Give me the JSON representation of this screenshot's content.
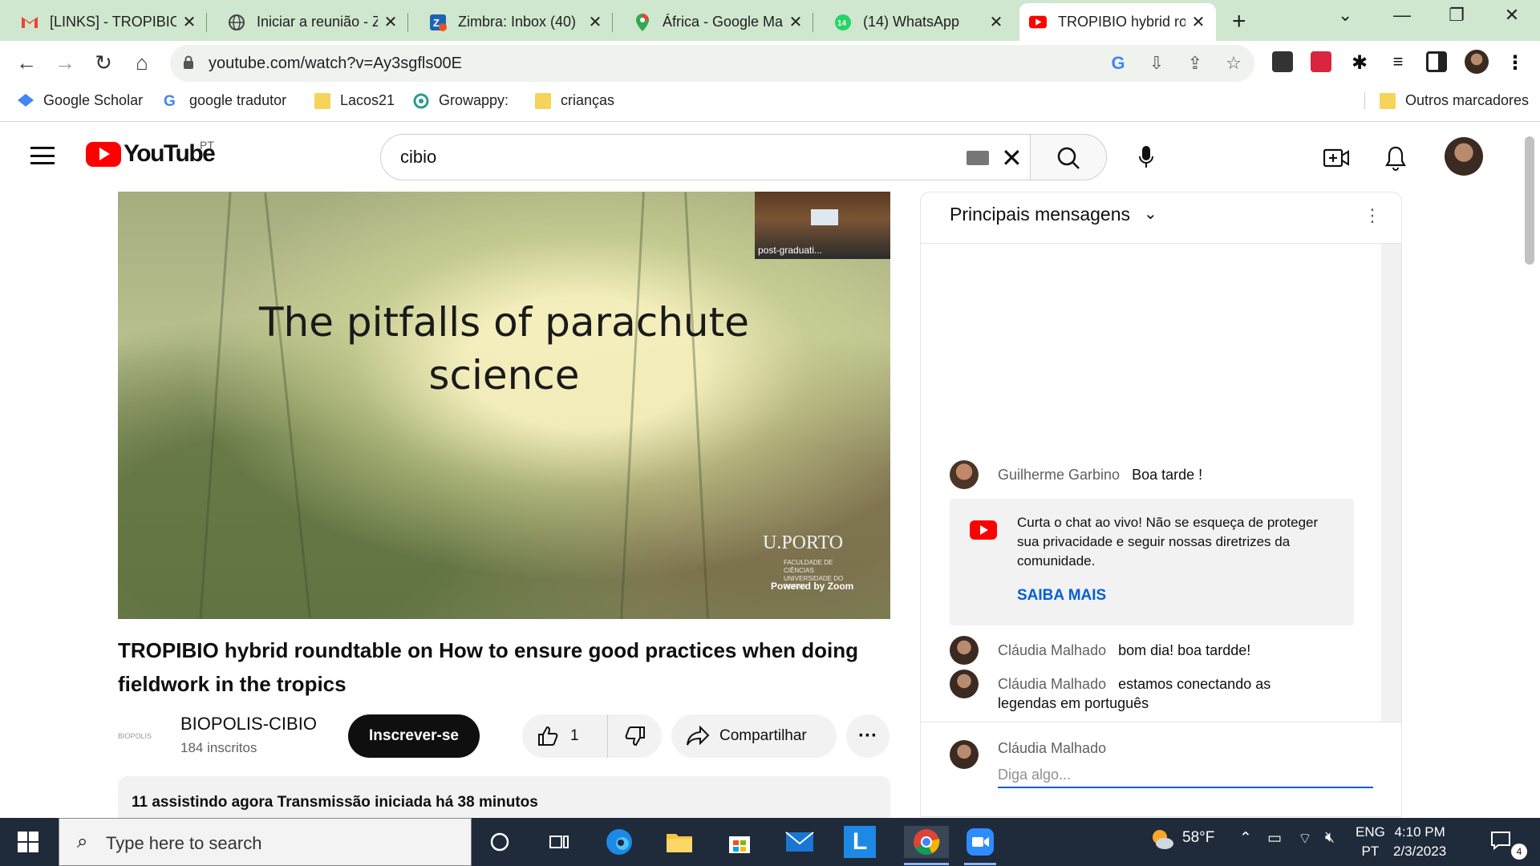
{
  "browser": {
    "tabs": [
      {
        "title": "[LINKS] - TROPIBIO",
        "icon": "gmail-icon"
      },
      {
        "title": "Iniciar a reunião - Z",
        "icon": "globe-icon"
      },
      {
        "title": "Zimbra: Inbox (40)",
        "icon": "zimbra-icon"
      },
      {
        "title": "África - Google Ma",
        "icon": "maps-icon"
      },
      {
        "title": "(14) WhatsApp",
        "icon": "whatsapp-icon"
      },
      {
        "title": "TROPIBIO hybrid ro",
        "icon": "youtube-icon",
        "active": true
      }
    ],
    "new_tab": "+",
    "url": "youtube.com/watch?v=Ay3sgfls00E",
    "bookmarks": [
      {
        "label": "Google Scholar",
        "icon": "scholar-icon"
      },
      {
        "label": "google tradutor",
        "icon": "google-icon"
      },
      {
        "label": "Lacos21",
        "icon": "folder-icon"
      },
      {
        "label": "Growappy:",
        "icon": "growappy-icon"
      },
      {
        "label": "crianças",
        "icon": "folder-icon"
      }
    ],
    "other_bookmarks": "Outros marcadores"
  },
  "youtube": {
    "region": "PT",
    "logo_text": "YouTube",
    "search_query": "cibio",
    "video": {
      "slide_title_line1": "The pitfalls of parachute",
      "slide_title_line2": "science",
      "pip_label": "post-graduati...",
      "brand": "U.PORTO",
      "brand_sub": "FACULDADE DE CIÊNCIAS UNIVERSIDADE DO PORTO",
      "powered": "Powered by Zoom"
    },
    "title": "TROPIBIO hybrid roundtable on How to ensure good practices when doing fieldwork in the tropics",
    "channel": {
      "name": "BIOPOLIS-CIBIO",
      "subscribers": "184 inscritos",
      "logo_text": "BIOPOLIS"
    },
    "subscribe_label": "Inscrever-se",
    "likes": "1",
    "share_label": "Compartilhar",
    "more_label": "···",
    "description_line": "11 assistindo agora  Transmissão iniciada há 38 minutos"
  },
  "chat": {
    "header": "Principais mensagens",
    "messages": [
      {
        "author": "Guilherme Garbino",
        "text": "Boa tarde !"
      },
      {
        "author": "Cláudia Malhado",
        "text": "bom dia! boa tardde!"
      },
      {
        "author": "Cláudia Malhado",
        "text": "estamos conectando as legendas em português"
      }
    ],
    "banner_text": "Curta o chat ao vivo! Não se esqueça de proteger sua privacidade e seguir nossas diretrizes da comunidade.",
    "banner_link": "SAIBA MAIS",
    "input_author": "Cláudia Malhado",
    "input_placeholder": "Diga algo..."
  },
  "taskbar": {
    "search_placeholder": "Type here to search",
    "weather": "58°F",
    "lang_top": "ENG",
    "lang_bottom": "PT",
    "time": "4:10 PM",
    "date": "2/3/2023",
    "notifications": "4"
  }
}
